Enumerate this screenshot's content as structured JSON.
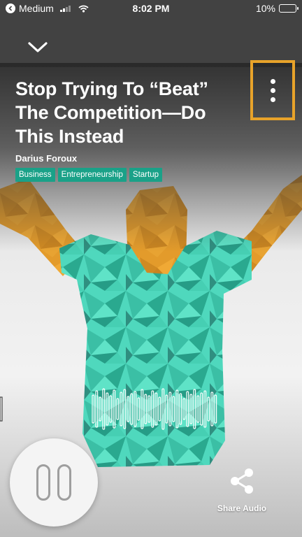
{
  "status_bar": {
    "carrier": "Medium",
    "time": "8:02 PM",
    "battery": "10%",
    "battery_level": 0.1,
    "battery_color": "#f5c518"
  },
  "header": {
    "collapse_icon": "chevron-down-icon",
    "more_icon": "more-vertical-icon",
    "highlight_color": "#e8a32a"
  },
  "story": {
    "title": "Stop Trying To “Beat” The Competition—Do This Instead",
    "author": "Darius Foroux",
    "tags": [
      "Business",
      "Entrepreneurship",
      "Startup"
    ],
    "tag_color": "#1aa188"
  },
  "player": {
    "state_icon": "pause-icon",
    "share_label": "Share Audio",
    "share_icon": "share-icon"
  },
  "artwork": {
    "description_colors": {
      "skin": "#e39b2b",
      "shirt": "#4fd8bd",
      "background": "#f0f0f0"
    }
  }
}
